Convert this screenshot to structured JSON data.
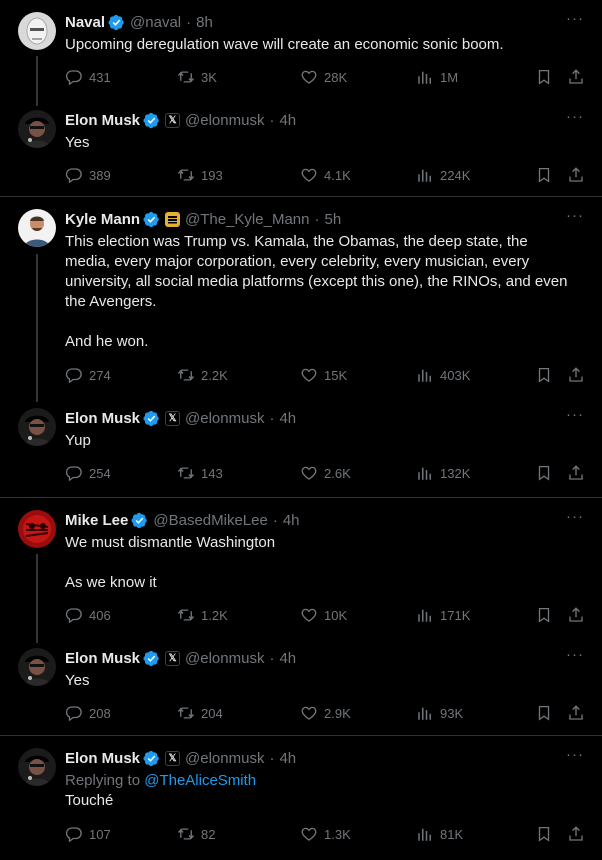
{
  "colors": {
    "background": "#000000",
    "text": "#e7e9ea",
    "muted": "#71767b",
    "link": "#1d9bf0",
    "verified": "#1d9bf0",
    "divider": "#2f3336"
  },
  "tweets": [
    {
      "name": "Naval",
      "handle": "@naval",
      "time": "8h",
      "has_affil": false,
      "text": "Upcoming deregulation wave will create an economic sonic boom.",
      "replies": "431",
      "retweets": "3K",
      "likes": "28K",
      "views": "1M"
    },
    {
      "name": "Elon Musk",
      "handle": "@elonmusk",
      "time": "4h",
      "has_affil": true,
      "affil_icon": "x-logo-icon",
      "text": "Yes",
      "replies": "389",
      "retweets": "193",
      "likes": "4.1K",
      "views": "224K"
    },
    {
      "name": "Kyle Mann",
      "handle": "@The_Kyle_Mann",
      "time": "5h",
      "has_affil": true,
      "affil_icon": "babylon-bee-icon",
      "text": "This election was Trump vs. Kamala, the Obamas, the deep state, the media, every major corporation, every celebrity, every musician, every university, all social media platforms (except this one), the RINOs, and even the Avengers.",
      "text2": "And he won.",
      "replies": "274",
      "retweets": "2.2K",
      "likes": "15K",
      "views": "403K"
    },
    {
      "name": "Elon Musk",
      "handle": "@elonmusk",
      "time": "4h",
      "has_affil": true,
      "affil_icon": "x-logo-icon",
      "text": "Yup",
      "replies": "254",
      "retweets": "143",
      "likes": "2.6K",
      "views": "132K"
    },
    {
      "name": "Mike Lee",
      "handle": "@BasedMikeLee",
      "time": "4h",
      "has_affil": false,
      "text": "We must dismantle Washington",
      "text2": "As we know it",
      "replies": "406",
      "retweets": "1.2K",
      "likes": "10K",
      "views": "171K"
    },
    {
      "name": "Elon Musk",
      "handle": "@elonmusk",
      "time": "4h",
      "has_affil": true,
      "affil_icon": "x-logo-icon",
      "text": "Yes",
      "replies": "208",
      "retweets": "204",
      "likes": "2.9K",
      "views": "93K"
    },
    {
      "name": "Elon Musk",
      "handle": "@elonmusk",
      "time": "4h",
      "has_affil": true,
      "affil_icon": "x-logo-icon",
      "reply_prefix": "Replying to",
      "reply_target": "@TheAliceSmith",
      "text": "Touché",
      "replies": "107",
      "retweets": "82",
      "likes": "1.3K",
      "views": "81K"
    }
  ],
  "sep": "·",
  "more_label": "···",
  "affil_x": "𝕏"
}
